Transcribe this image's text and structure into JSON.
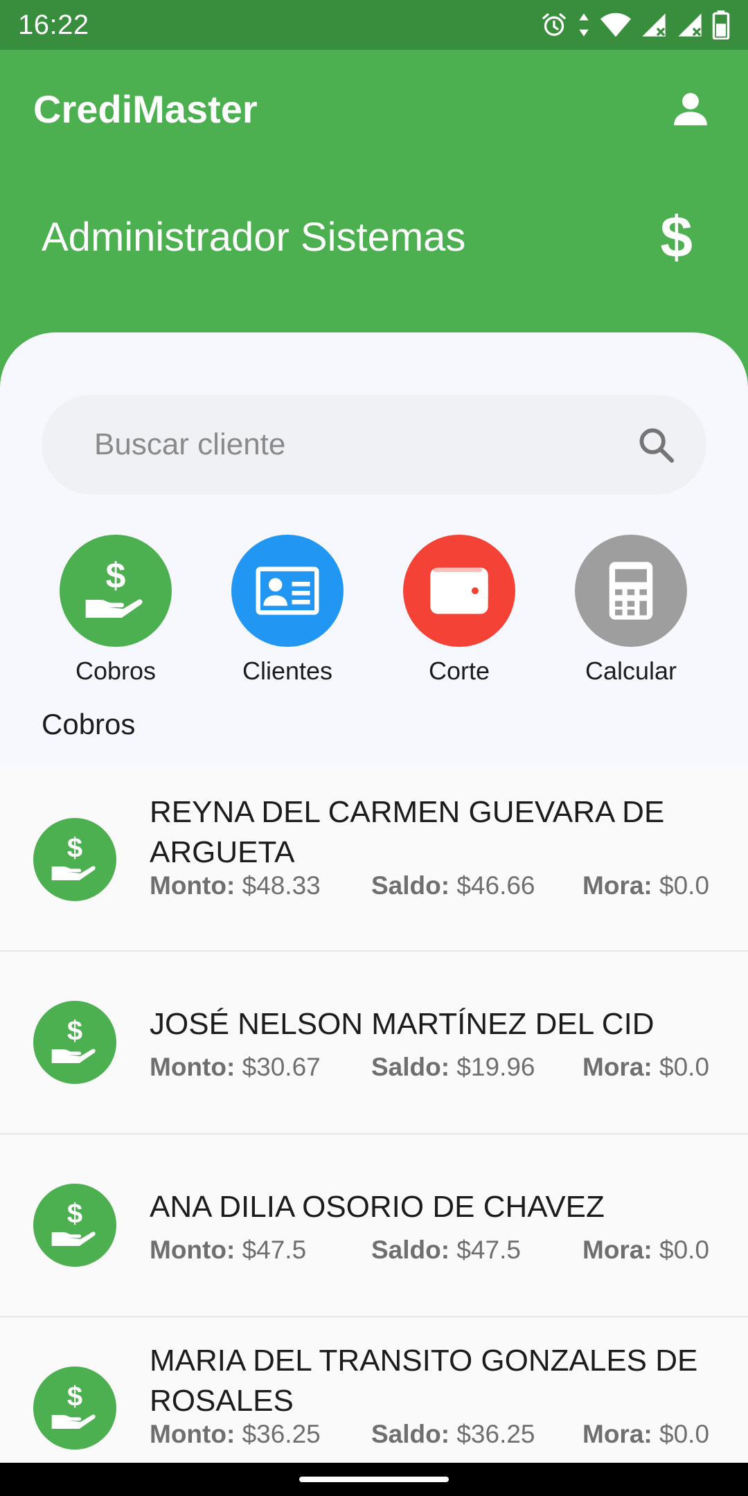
{
  "status_bar": {
    "time": "16:22",
    "icons": [
      "alarm-icon",
      "data-arrows-icon",
      "wifi-icon",
      "signal-icon",
      "signal-icon",
      "battery-icon"
    ]
  },
  "app": {
    "title": "CrediMaster",
    "account_icon": "person-icon"
  },
  "header": {
    "user_name": "Administrador Sistemas",
    "currency_icon": "$"
  },
  "search": {
    "placeholder": "Buscar cliente",
    "value": ""
  },
  "actions": [
    {
      "label": "Cobros",
      "icon": "cash-hand-icon",
      "color": "#4caf50"
    },
    {
      "label": "Clientes",
      "icon": "id-card-icon",
      "color": "#2196f3"
    },
    {
      "label": "Corte",
      "icon": "wallet-icon",
      "color": "#f44336"
    },
    {
      "label": "Calcular",
      "icon": "calculator-icon",
      "color": "#9e9e9e"
    }
  ],
  "section_title": "Cobros",
  "labels": {
    "monto": "Monto:",
    "saldo": "Saldo:",
    "mora": "Mora:"
  },
  "cobros": [
    {
      "name": "REYNA DEL CARMEN GUEVARA DE ARGUETA",
      "monto": "$48.33",
      "saldo": "$46.66",
      "mora": "$0.0"
    },
    {
      "name": "JOSÉ NELSON MARTÍNEZ DEL CID",
      "monto": "$30.67",
      "saldo": "$19.96",
      "mora": "$0.0"
    },
    {
      "name": "ANA DILIA OSORIO DE CHAVEZ",
      "monto": "$47.5",
      "saldo": "$47.5",
      "mora": "$0.0"
    },
    {
      "name": "MARIA DEL TRANSITO GONZALES DE ROSALES",
      "monto": "$36.25",
      "saldo": "$36.25",
      "mora": "$0.0"
    }
  ],
  "colors": {
    "primary": "#4caf50",
    "status_bar": "#388e3c",
    "blue": "#2196f3",
    "red": "#f44336",
    "grey": "#9e9e9e"
  }
}
